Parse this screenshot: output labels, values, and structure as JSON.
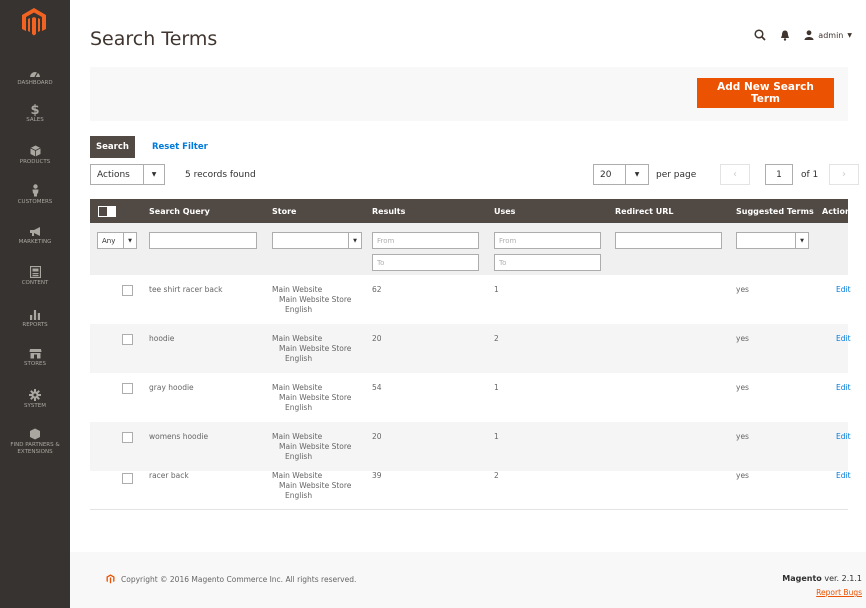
{
  "sidebar": {
    "items": [
      {
        "label": "Dashboard",
        "icon": "dashboard-icon"
      },
      {
        "label": "Sales",
        "icon": "dollar-icon"
      },
      {
        "label": "Products",
        "icon": "cube-icon"
      },
      {
        "label": "Customers",
        "icon": "person-icon"
      },
      {
        "label": "Marketing",
        "icon": "megaphone-icon"
      },
      {
        "label": "Content",
        "icon": "content-icon"
      },
      {
        "label": "Reports",
        "icon": "bar-chart-icon"
      },
      {
        "label": "Stores",
        "icon": "store-icon"
      },
      {
        "label": "System",
        "icon": "gear-icon"
      },
      {
        "label": "Find Partners & Extensions",
        "icon": "extensions-icon"
      }
    ]
  },
  "header": {
    "title": "Search Terms",
    "user": "admin",
    "search_icon": "search-icon",
    "bell_icon": "bell-icon",
    "user_icon": "user-icon"
  },
  "action_bar": {
    "add_button": "Add New Search Term"
  },
  "toolbar": {
    "search_button": "Search",
    "reset_filter": "Reset Filter",
    "actions": "Actions",
    "records_found": "5 records found",
    "per_page_value": "20",
    "per_page_label": "per page",
    "page_current": "1",
    "page_of": "of 1",
    "prev": "‹",
    "next": "›"
  },
  "grid": {
    "columns": [
      "Search Query",
      "Store",
      "Results",
      "Uses",
      "Redirect URL",
      "Suggested Terms",
      "Action"
    ],
    "filters": {
      "any": "Any",
      "from": "From",
      "to": "To"
    },
    "rows": [
      {
        "query": "tee shirt racer back",
        "store1": "Main Website",
        "store2": "Main Website Store",
        "store3": "English",
        "results": "62",
        "uses": "1",
        "redirect": "",
        "suggested": "yes",
        "action": "Edit"
      },
      {
        "query": "hoodie",
        "store1": "Main Website",
        "store2": "Main Website Store",
        "store3": "English",
        "results": "20",
        "uses": "2",
        "redirect": "",
        "suggested": "yes",
        "action": "Edit"
      },
      {
        "query": "gray hoodie",
        "store1": "Main Website",
        "store2": "Main Website Store",
        "store3": "English",
        "results": "54",
        "uses": "1",
        "redirect": "",
        "suggested": "yes",
        "action": "Edit"
      },
      {
        "query": "womens hoodie",
        "store1": "Main Website",
        "store2": "Main Website Store",
        "store3": "English",
        "results": "20",
        "uses": "1",
        "redirect": "",
        "suggested": "yes",
        "action": "Edit"
      },
      {
        "query": "racer back",
        "store1": "Main Website",
        "store2": "Main Website Store",
        "store3": "English",
        "results": "39",
        "uses": "2",
        "redirect": "",
        "suggested": "yes",
        "action": "Edit"
      }
    ]
  },
  "footer": {
    "copyright": "Copyright © 2016 Magento Commerce Inc. All rights reserved.",
    "brand": "Magento",
    "version": "ver. 2.1.1",
    "report_bugs": "Report Bugs"
  },
  "colors": {
    "accent": "#eb5202",
    "sidebar": "#373330",
    "header": "#514943",
    "link": "#007bdb"
  }
}
